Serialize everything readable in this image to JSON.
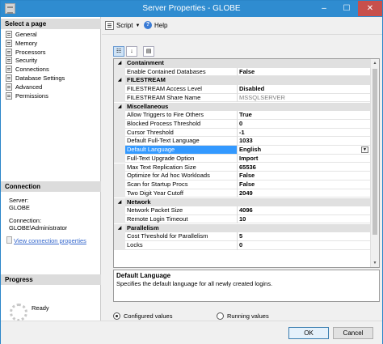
{
  "window": {
    "title": "Server Properties - GLOBE",
    "controls": {
      "minimize": "–",
      "maximize": "☐",
      "close": "✕"
    }
  },
  "left_panel": {
    "select_page_header": "Select a page",
    "pages": [
      "General",
      "Memory",
      "Processors",
      "Security",
      "Connections",
      "Database Settings",
      "Advanced",
      "Permissions"
    ],
    "connection_header": "Connection",
    "server_label": "Server:",
    "server_value": "GLOBE",
    "connection_label": "Connection:",
    "connection_value": "GLOBE\\Administrator",
    "view_properties_link": "View connection properties",
    "progress_header": "Progress",
    "progress_status": "Ready"
  },
  "toolbar": {
    "script_label": "Script",
    "help_label": "Help"
  },
  "grid": {
    "rows": [
      {
        "type": "category",
        "name": "Containment",
        "expander": "◢"
      },
      {
        "type": "property",
        "name": "Enable Contained Databases",
        "value": "False"
      },
      {
        "type": "category",
        "name": "FILESTREAM",
        "expander": "◢"
      },
      {
        "type": "property",
        "name": "FILESTREAM Access Level",
        "value": "Disabled"
      },
      {
        "type": "property",
        "name": "FILESTREAM Share Name",
        "value": "MSSQLSERVER",
        "readonly": true
      },
      {
        "type": "category",
        "name": "Miscellaneous",
        "expander": "◢"
      },
      {
        "type": "property",
        "name": "Allow Triggers to Fire Others",
        "value": "True"
      },
      {
        "type": "property",
        "name": "Blocked Process Threshold",
        "value": "0"
      },
      {
        "type": "property",
        "name": "Cursor Threshold",
        "value": "-1"
      },
      {
        "type": "property",
        "name": "Default Full-Text Language",
        "value": "1033"
      },
      {
        "type": "property",
        "name": "Default Language",
        "value": "English",
        "selected": true,
        "dropdown": true
      },
      {
        "type": "property",
        "name": "Full-Text Upgrade Option",
        "value": "Import"
      },
      {
        "type": "property",
        "name": "Max Text Replication Size",
        "value": "65536"
      },
      {
        "type": "property",
        "name": "Optimize for Ad hoc Workloads",
        "value": "False"
      },
      {
        "type": "property",
        "name": "Scan for Startup Procs",
        "value": "False"
      },
      {
        "type": "property",
        "name": "Two Digit Year Cutoff",
        "value": "2049"
      },
      {
        "type": "category",
        "name": "Network",
        "expander": "◢"
      },
      {
        "type": "property",
        "name": "Network Packet Size",
        "value": "4096"
      },
      {
        "type": "property",
        "name": "Remote Login Timeout",
        "value": "10"
      },
      {
        "type": "category",
        "name": "Parallelism",
        "expander": "◢"
      },
      {
        "type": "property",
        "name": "Cost Threshold for Parallelism",
        "value": "5"
      },
      {
        "type": "property",
        "name": "Locks",
        "value": "0"
      }
    ]
  },
  "description": {
    "title": "Default Language",
    "text": "Specifies the default language for all newly created logins."
  },
  "view_options": {
    "configured": "Configured values",
    "running": "Running values",
    "selected": "configured"
  },
  "buttons": {
    "ok": "OK",
    "cancel": "Cancel"
  },
  "colors": {
    "titlebar": "#2f8cd0",
    "selection": "#3399ff",
    "close": "#c7504c"
  }
}
